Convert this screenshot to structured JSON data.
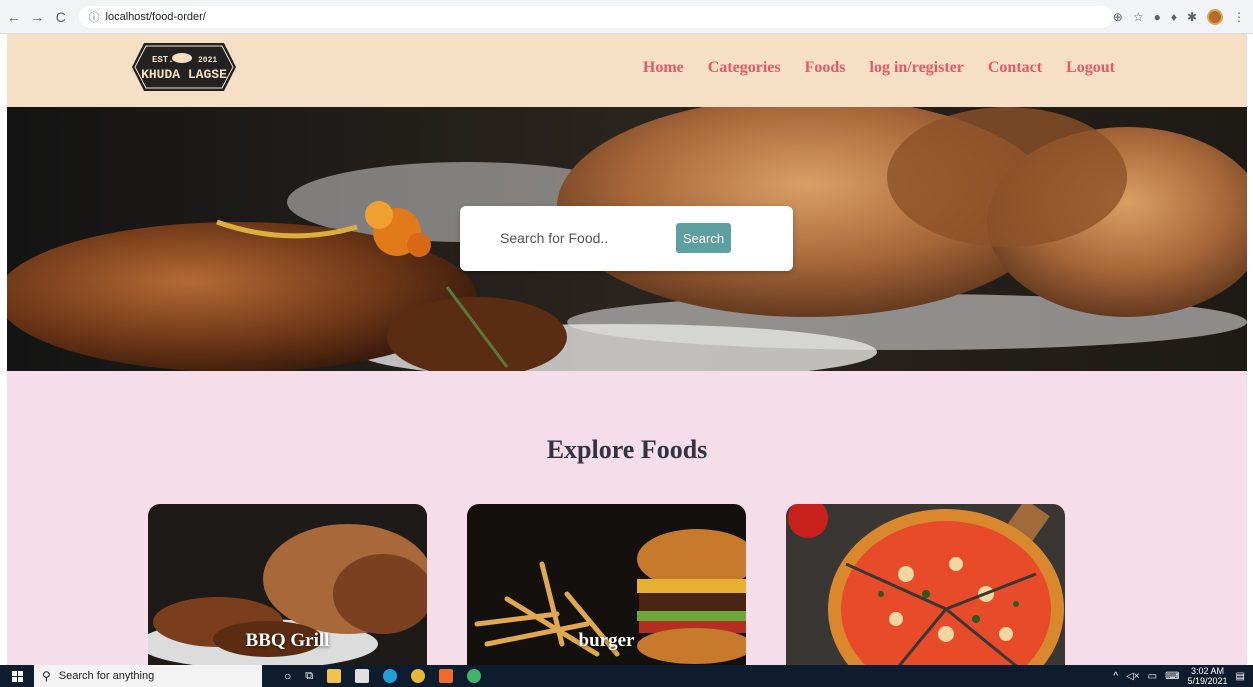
{
  "browser": {
    "url": "localhost/food-order/",
    "back_icon": "arrow-left-icon",
    "forward_icon": "arrow-right-icon",
    "reload_icon": "reload-icon"
  },
  "site": {
    "logo_text_top": "EST.",
    "logo_text_year": "2021",
    "logo_text_name": "KHUDA LAGSE",
    "nav": [
      {
        "label": "Home"
      },
      {
        "label": "Categories"
      },
      {
        "label": "Foods"
      },
      {
        "label": "log in/register"
      },
      {
        "label": "Contact"
      },
      {
        "label": "Logout"
      }
    ],
    "accent_color": "#e05a68",
    "header_bg": "#f6e0c5"
  },
  "search": {
    "placeholder": "Search for Food..",
    "button_label": "Search"
  },
  "explore": {
    "title": "Explore Foods",
    "categories": [
      {
        "label": "BBQ Grill"
      },
      {
        "label": "burger"
      },
      {
        "label": ""
      }
    ]
  },
  "taskbar": {
    "search_placeholder": "Search for anything",
    "time": "3:02 AM",
    "date": "5/19/2021"
  }
}
